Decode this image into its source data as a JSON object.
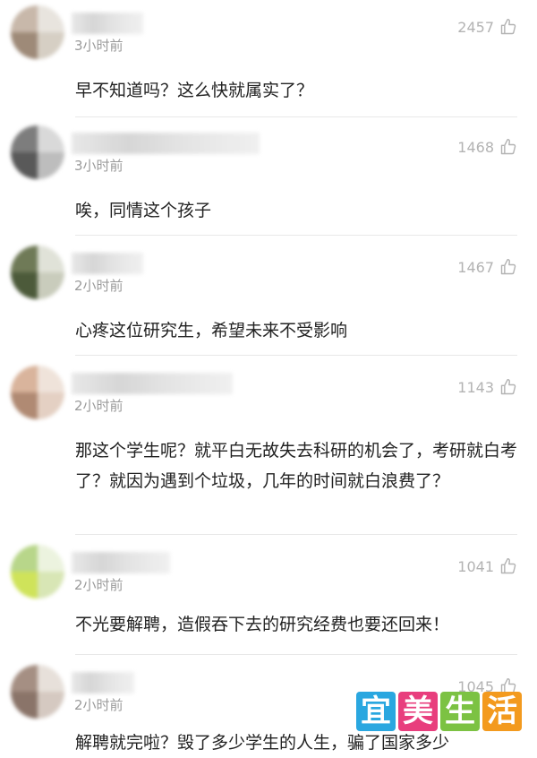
{
  "comments": [
    {
      "time": "3小时前",
      "likes": "2457",
      "text": "早不知道吗？这么快就属实了？"
    },
    {
      "time": "3小时前",
      "likes": "1468",
      "text": "唉，同情这个孩子"
    },
    {
      "time": "2小时前",
      "likes": "1467",
      "text": "心疼这位研究生，希望未来不受影响"
    },
    {
      "time": "2小时前",
      "likes": "1143",
      "text": "那这个学生呢？就平白无故失去科研的机会了，考研就白考了？就因为遇到个垃圾，几年的时间就白浪费了？"
    },
    {
      "time": "2小时前",
      "likes": "1041",
      "text": "不光要解聘，造假吞下去的研究经费也要还回来！"
    },
    {
      "time": "2小时前",
      "likes": "1045",
      "text": "解聘就完啦？毁了多少学生的人生，骗了国家多少"
    }
  ],
  "watermark": {
    "chars": [
      "宜",
      "美",
      "生",
      "活"
    ],
    "colors": [
      "#2aa7e0",
      "#e83e7d",
      "#7cc243",
      "#f39a1e"
    ]
  },
  "icons": {
    "like": "thumbs-up-icon"
  }
}
